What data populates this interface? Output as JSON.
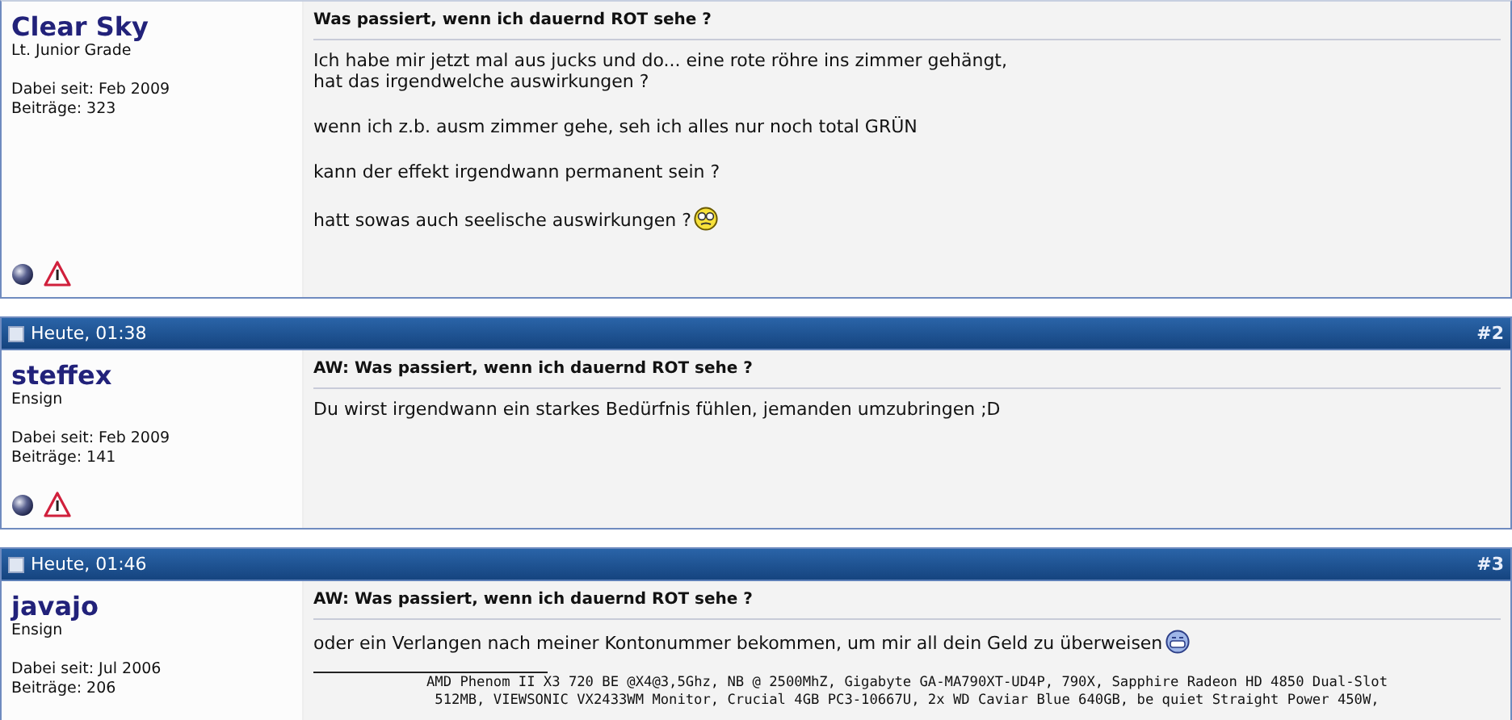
{
  "posts": [
    {
      "user": {
        "name": "Clear Sky",
        "rank": "Lt. Junior Grade",
        "joined": "Dabei seit: Feb 2009",
        "posts": "Beiträge: 323"
      },
      "title": "Was passiert, wenn ich dauernd ROT sehe ?",
      "paragraphs": [
        {
          "text": "Ich habe mir jetzt mal aus jucks und do... eine rote röhre ins zimmer gehängt,\nhat das irgendwelche auswirkungen ?"
        },
        {
          "text": "wenn ich z.b. ausm zimmer gehe, seh ich alles nur noch total GRÜN"
        },
        {
          "text": "kann der effekt irgendwann permanent sein ?"
        },
        {
          "text": "hatt sowas auch seelische auswirkungen ?",
          "kind": "confused"
        }
      ],
      "show_icons": true
    },
    {
      "date": "Heute, 01:38",
      "number": "#2",
      "user": {
        "name": "steffex",
        "rank": "Ensign",
        "joined": "Dabei seit: Feb 2009",
        "posts": "Beiträge: 141"
      },
      "title": "AW: Was passiert, wenn ich dauernd ROT sehe ?",
      "paragraphs": [
        {
          "text": "Du wirst irgendwann ein starkes Bedürfnis fühlen, jemanden umzubringen ;D"
        }
      ],
      "show_icons": true
    },
    {
      "date": "Heute, 01:46",
      "number": "#3",
      "user": {
        "name": "javajo",
        "rank": "Ensign",
        "joined": "Dabei seit: Jul 2006",
        "posts": "Beiträge: 206"
      },
      "title": "AW: Was passiert, wenn ich dauernd ROT sehe ?",
      "paragraphs": [
        {
          "text": "oder ein Verlangen nach meiner Kontonummer bekommen, um mir all dein Geld zu überweisen",
          "kind": "grin"
        }
      ],
      "signature": "AMD Phenom II X3 720 BE @X4@3,5Ghz, NB @ 2500MhZ, Gigabyte GA-MA790XT-UD4P, 790X, Sapphire Radeon HD 4850 Dual-Slot\n512MB, VIEWSONIC VX2433WM Monitor, Crucial 4GB PC3-10667U, 2x WD Caviar Blue 640GB, be quiet Straight Power 450W,",
      "show_icons": false
    }
  ]
}
